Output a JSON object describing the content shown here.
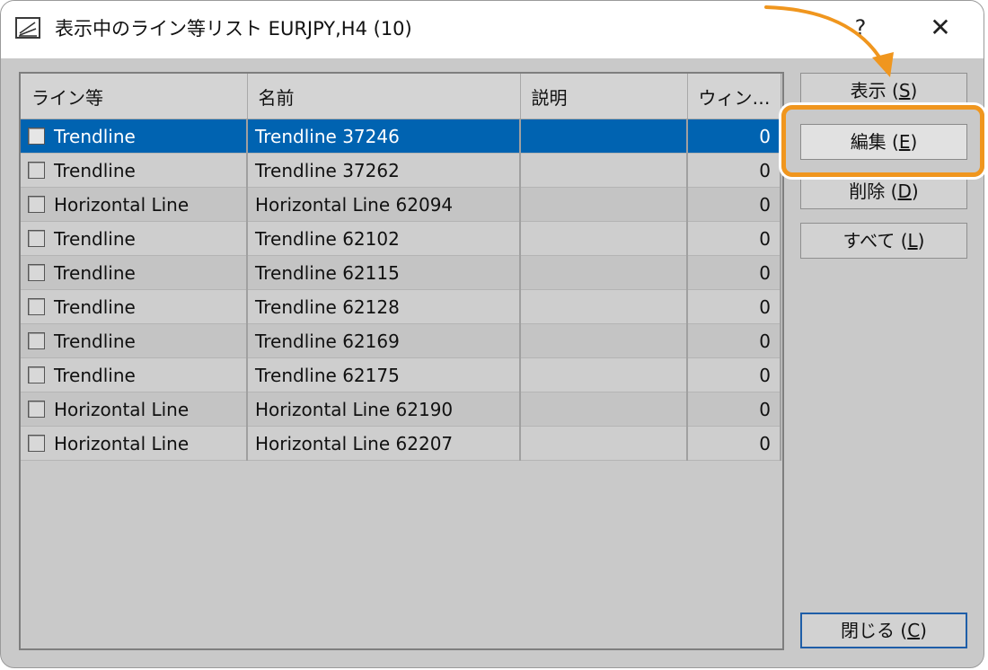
{
  "window": {
    "title": "表示中のライン等リスト EURJPY,H4 (10)",
    "help": "?",
    "close": "✕"
  },
  "columns": [
    "ライン等",
    "名前",
    "説明",
    "ウィン…"
  ],
  "rows": [
    {
      "type": "Trendline",
      "name": "Trendline 37246",
      "description": "",
      "window": "0",
      "selected": true
    },
    {
      "type": "Trendline",
      "name": "Trendline 37262",
      "description": "",
      "window": "0"
    },
    {
      "type": "Horizontal Line",
      "name": "Horizontal Line 62094",
      "description": "",
      "window": "0"
    },
    {
      "type": "Trendline",
      "name": "Trendline 62102",
      "description": "",
      "window": "0"
    },
    {
      "type": "Trendline",
      "name": "Trendline 62115",
      "description": "",
      "window": "0"
    },
    {
      "type": "Trendline",
      "name": "Trendline 62128",
      "description": "",
      "window": "0"
    },
    {
      "type": "Trendline",
      "name": "Trendline 62169",
      "description": "",
      "window": "0"
    },
    {
      "type": "Trendline",
      "name": "Trendline 62175",
      "description": "",
      "window": "0"
    },
    {
      "type": "Horizontal Line",
      "name": "Horizontal Line 62190",
      "description": "",
      "window": "0"
    },
    {
      "type": "Horizontal Line",
      "name": "Horizontal Line 62207",
      "description": "",
      "window": "0"
    }
  ],
  "buttons": {
    "show": {
      "label": "表示 (",
      "key": "S",
      "end": ")"
    },
    "edit": {
      "label": "編集 (",
      "key": "E",
      "end": ")"
    },
    "delete": {
      "label": "削除 (",
      "key": "D",
      "end": ")"
    },
    "all": {
      "label": "すべて (",
      "key": "L",
      "end": ")"
    },
    "close": {
      "label": "閉じる (",
      "key": "C",
      "end": ")"
    }
  },
  "colors": {
    "selection": "#0063b1",
    "highlight": "#f0961e",
    "close_border": "#1f5ea8"
  },
  "icons": {
    "app": "chart-lines-icon",
    "help": "question-mark-icon",
    "close": "close-icon",
    "annotation": "curved-arrow-icon"
  }
}
